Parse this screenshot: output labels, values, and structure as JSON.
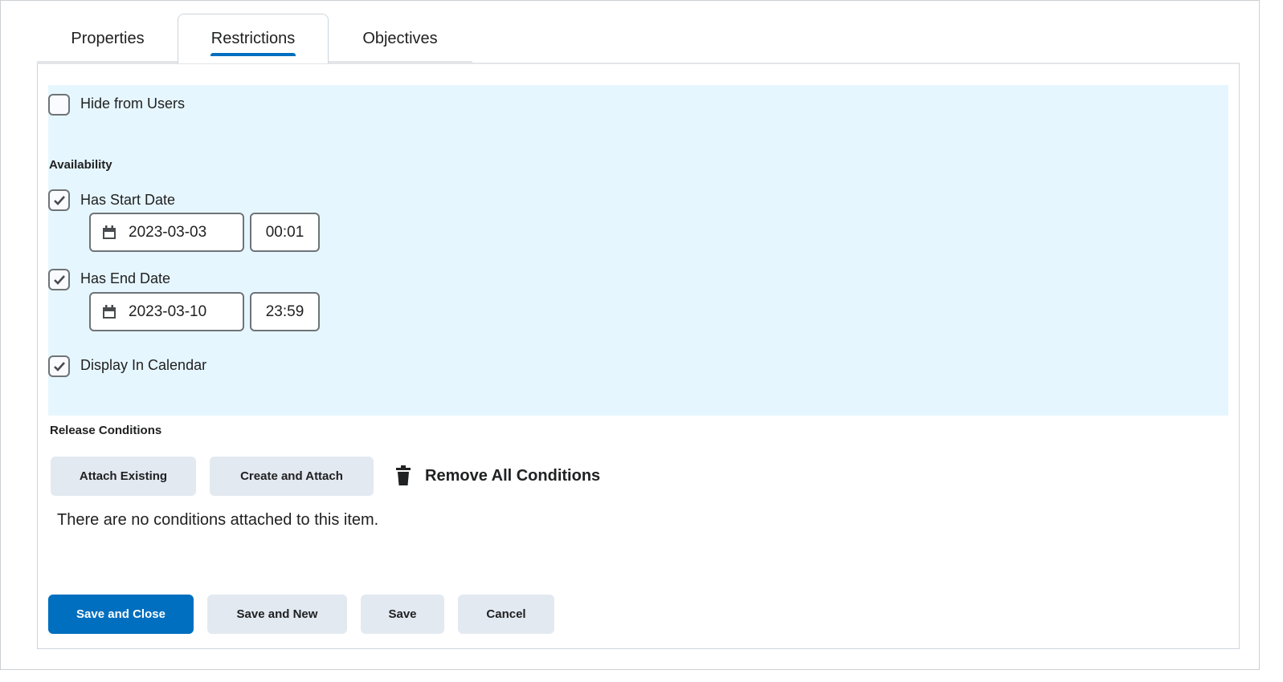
{
  "tabs": [
    {
      "label": "Properties"
    },
    {
      "label": "Restrictions",
      "active": true
    },
    {
      "label": "Objectives"
    }
  ],
  "hide_from_users": {
    "label": "Hide from Users",
    "checked": false
  },
  "availability": {
    "heading": "Availability",
    "start": {
      "label": "Has Start Date",
      "checked": true,
      "date": "2023-03-03",
      "time": "00:01"
    },
    "end": {
      "label": "Has End Date",
      "checked": true,
      "date": "2023-03-10",
      "time": "23:59"
    },
    "calendar": {
      "label": "Display In Calendar",
      "checked": true
    }
  },
  "release": {
    "heading": "Release Conditions",
    "attach_existing": "Attach Existing",
    "create_attach": "Create and Attach",
    "remove_all": "Remove All Conditions",
    "empty": "There are no conditions attached to this item."
  },
  "footer": {
    "save_close": "Save and Close",
    "save_new": "Save and New",
    "save": "Save",
    "cancel": "Cancel"
  },
  "colors": {
    "accent": "#006fbf",
    "highlight": "#e6f6fe"
  }
}
